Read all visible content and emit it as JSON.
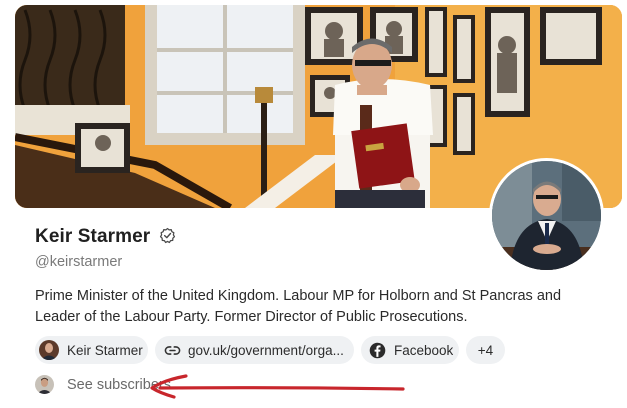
{
  "profile": {
    "name": "Keir Starmer",
    "handle": "@keirstarmer",
    "bio": "Prime Minister of the United Kingdom. Labour MP for Holborn and St Pancras and Leader of the Labour Party. Former Director of Public Prosecutions.",
    "verified": true
  },
  "chips": [
    {
      "icon": "avatar",
      "label": "Keir Starmer"
    },
    {
      "icon": "link-icon",
      "label": "gov.uk/government/orga..."
    },
    {
      "icon": "facebook-icon",
      "label": "Facebook"
    },
    {
      "icon": "",
      "label": "+4"
    }
  ],
  "subscribers": {
    "label": "See subscribers"
  },
  "colors": {
    "banner_wall": "#f0a23c",
    "chip_background": "#eff1f3",
    "annotation": "#c8262c"
  }
}
